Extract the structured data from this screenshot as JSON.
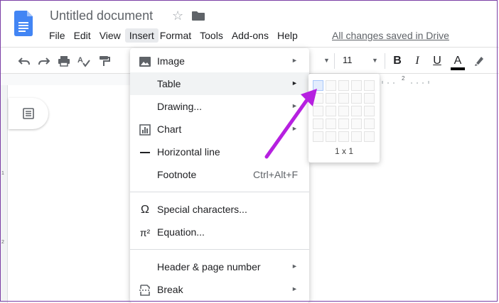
{
  "document": {
    "title": "Untitled document",
    "status": "All changes saved in Drive"
  },
  "menubar": {
    "items": [
      "File",
      "Edit",
      "View",
      "Insert",
      "Format",
      "Tools",
      "Add-ons",
      "Help"
    ],
    "active": "Insert"
  },
  "toolbar": {
    "font_size": "11",
    "buttons": [
      "undo-icon",
      "redo-icon",
      "print-icon",
      "spellcheck-icon",
      "paint-format-icon",
      "bold-icon",
      "italic-icon",
      "underline-icon",
      "text-color-icon",
      "highlight-icon"
    ],
    "bold_label": "B",
    "italic_label": "I",
    "underline_label": "U",
    "text_color_label": "A"
  },
  "ruler": {
    "top_mark": "2",
    "left_marks": [
      "1",
      "2"
    ]
  },
  "insert_menu": {
    "items": [
      {
        "label": "Image",
        "icon": "image-icon",
        "submenu": true
      },
      {
        "label": "Table",
        "icon": "",
        "submenu": true,
        "highlighted": true
      },
      {
        "label": "Drawing...",
        "icon": "",
        "submenu": true
      },
      {
        "label": "Chart",
        "icon": "chart-icon",
        "submenu": true
      },
      {
        "label": "Horizontal line",
        "icon": "horizontal-line-icon",
        "submenu": false
      },
      {
        "label": "Footnote",
        "icon": "",
        "shortcut": "Ctrl+Alt+F"
      },
      {
        "label": "Special characters...",
        "icon": "omega-icon",
        "submenu": false
      },
      {
        "label": "Equation...",
        "icon": "pi-icon",
        "submenu": false
      },
      {
        "label": "Header & page number",
        "icon": "",
        "submenu": true
      },
      {
        "label": "Break",
        "icon": "break-icon",
        "submenu": true
      }
    ]
  },
  "table_picker": {
    "rows": 5,
    "cols": 5,
    "selected_rows": 1,
    "selected_cols": 1,
    "label": "1 x 1"
  },
  "colors": {
    "docs_blue": "#4285f4",
    "annotation_arrow": "#b620e0",
    "frame": "#7b3fa5"
  }
}
